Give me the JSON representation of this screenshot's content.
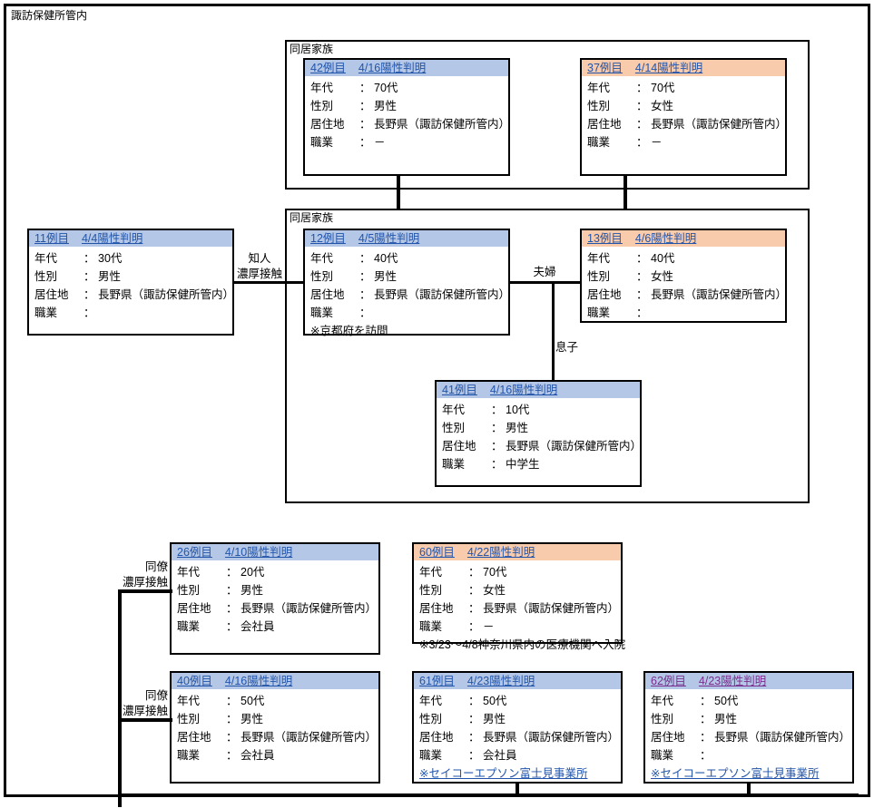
{
  "page": {
    "region_title": "諏訪保健所管内"
  },
  "groups": [
    {
      "label": "同居家族"
    },
    {
      "label": "同居家族"
    }
  ],
  "labels": {
    "k_age": "年代",
    "k_sex": "性別",
    "k_residence": "居住地",
    "k_occupation": "職業",
    "colon": "："
  },
  "relations": {
    "acquaintance": "知人",
    "close_contact": "濃厚接触",
    "couple": "夫婦",
    "son": "息子",
    "colleague": "同僚"
  },
  "colors": {
    "male_header": "#b4c7e7",
    "female_header": "#f8cbad",
    "link": "#2255aa",
    "link_visited": "#7b2d8e",
    "line": "#000000"
  },
  "cases": {
    "c42": {
      "no": "42例目",
      "date": "4/16陽性判明",
      "age": "70代",
      "sex": "男性",
      "residence": "長野県（諏訪保健所管内）",
      "occupation": "－",
      "note": ""
    },
    "c37": {
      "no": "37例目",
      "date": "4/14陽性判明",
      "age": "70代",
      "sex": "女性",
      "residence": "長野県（諏訪保健所管内）",
      "occupation": "－",
      "note": ""
    },
    "c11": {
      "no": "11例目",
      "date": "4/4陽性判明",
      "age": "30代",
      "sex": "男性",
      "residence": "長野県（諏訪保健所管内）",
      "occupation": "",
      "note": ""
    },
    "c12": {
      "no": "12例目",
      "date": "4/5陽性判明",
      "age": "40代",
      "sex": "男性",
      "residence": "長野県（諏訪保健所管内）",
      "occupation": "",
      "note": "※京都府を訪問"
    },
    "c13": {
      "no": "13例目",
      "date": "4/6陽性判明",
      "age": "40代",
      "sex": "女性",
      "residence": "長野県（諏訪保健所管内）",
      "occupation": "",
      "note": ""
    },
    "c41": {
      "no": "41例目",
      "date": "4/16陽性判明",
      "age": "10代",
      "sex": "男性",
      "residence": "長野県（諏訪保健所管内）",
      "occupation": "中学生",
      "note": ""
    },
    "c26": {
      "no": "26例目",
      "date": "4/10陽性判明",
      "age": "20代",
      "sex": "男性",
      "residence": "長野県（諏訪保健所管内）",
      "occupation": "会社員",
      "note": ""
    },
    "c60": {
      "no": "60例目",
      "date": "4/22陽性判明",
      "age": "70代",
      "sex": "女性",
      "residence": "長野県（諏訪保健所管内）",
      "occupation": "－",
      "note": "※3/23～4/8神奈川県内の医療機関へ入院"
    },
    "c40": {
      "no": "40例目",
      "date": "4/16陽性判明",
      "age": "50代",
      "sex": "男性",
      "residence": "長野県（諏訪保健所管内）",
      "occupation": "会社員",
      "note": ""
    },
    "c61": {
      "no": "61例目",
      "date": "4/23陽性判明",
      "age": "50代",
      "sex": "男性",
      "residence": "長野県（諏訪保健所管内）",
      "occupation": "会社員",
      "note": "※セイコーエプソン富士見事業所"
    },
    "c62": {
      "no": "62例目",
      "date": "4/23陽性判明",
      "age": "50代",
      "sex": "男性",
      "residence": "長野県（諏訪保健所管内）",
      "occupation": "",
      "note": "※セイコーエプソン富士見事業所"
    }
  }
}
